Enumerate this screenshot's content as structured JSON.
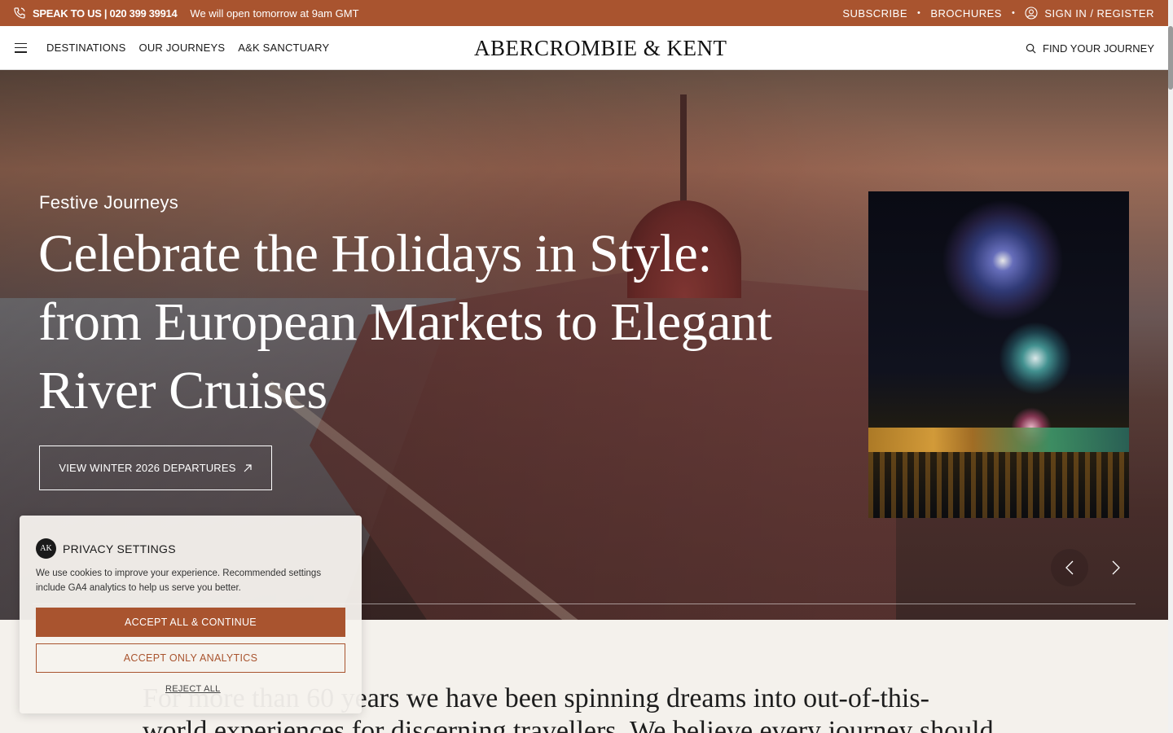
{
  "topbar": {
    "speak": "SPEAK TO US | 020 399 39914",
    "open_message": "We will open tomorrow at 9am GMT",
    "subscribe": "SUBSCRIBE",
    "brochures": "BROCHURES",
    "signin": "SIGN IN / REGISTER",
    "separator": "•",
    "bg_color": "#a9542f"
  },
  "nav": {
    "links": [
      "DESTINATIONS",
      "OUR JOURNEYS",
      "A&K SANCTUARY"
    ],
    "logo": "ABERCROMBIE & KENT",
    "find": "FIND YOUR JOURNEY"
  },
  "hero": {
    "eyebrow": "Festive Journeys",
    "headline_lines": [
      "Celebrate the Holidays in Style:",
      "from European Markets to Elegant",
      "River Cruises"
    ],
    "cta": "VIEW WINTER 2026 DEPARTURES"
  },
  "intro": {
    "text_line1": "For more than 60 years we have been spinning dreams into out-of-this-",
    "text_line2": "world experiences for discerning travellers. We believe every journey should"
  },
  "privacy": {
    "logo_text": "AK",
    "title": "PRIVACY SETTINGS",
    "body": "We use cookies to improve your experience. Recommended settings include GA4 analytics to help us serve you better.",
    "accept_all": "ACCEPT ALL & CONTINUE",
    "accept_analytics": "ACCEPT ONLY ANALYTICS",
    "reject_all": "REJECT ALL"
  },
  "icons": {
    "phone": "phone-icon",
    "user": "user-icon",
    "menu": "menu-icon",
    "search": "search-icon",
    "arrow": "arrow-up-right-icon",
    "prev": "chevron-left-icon",
    "next": "chevron-right-icon"
  }
}
